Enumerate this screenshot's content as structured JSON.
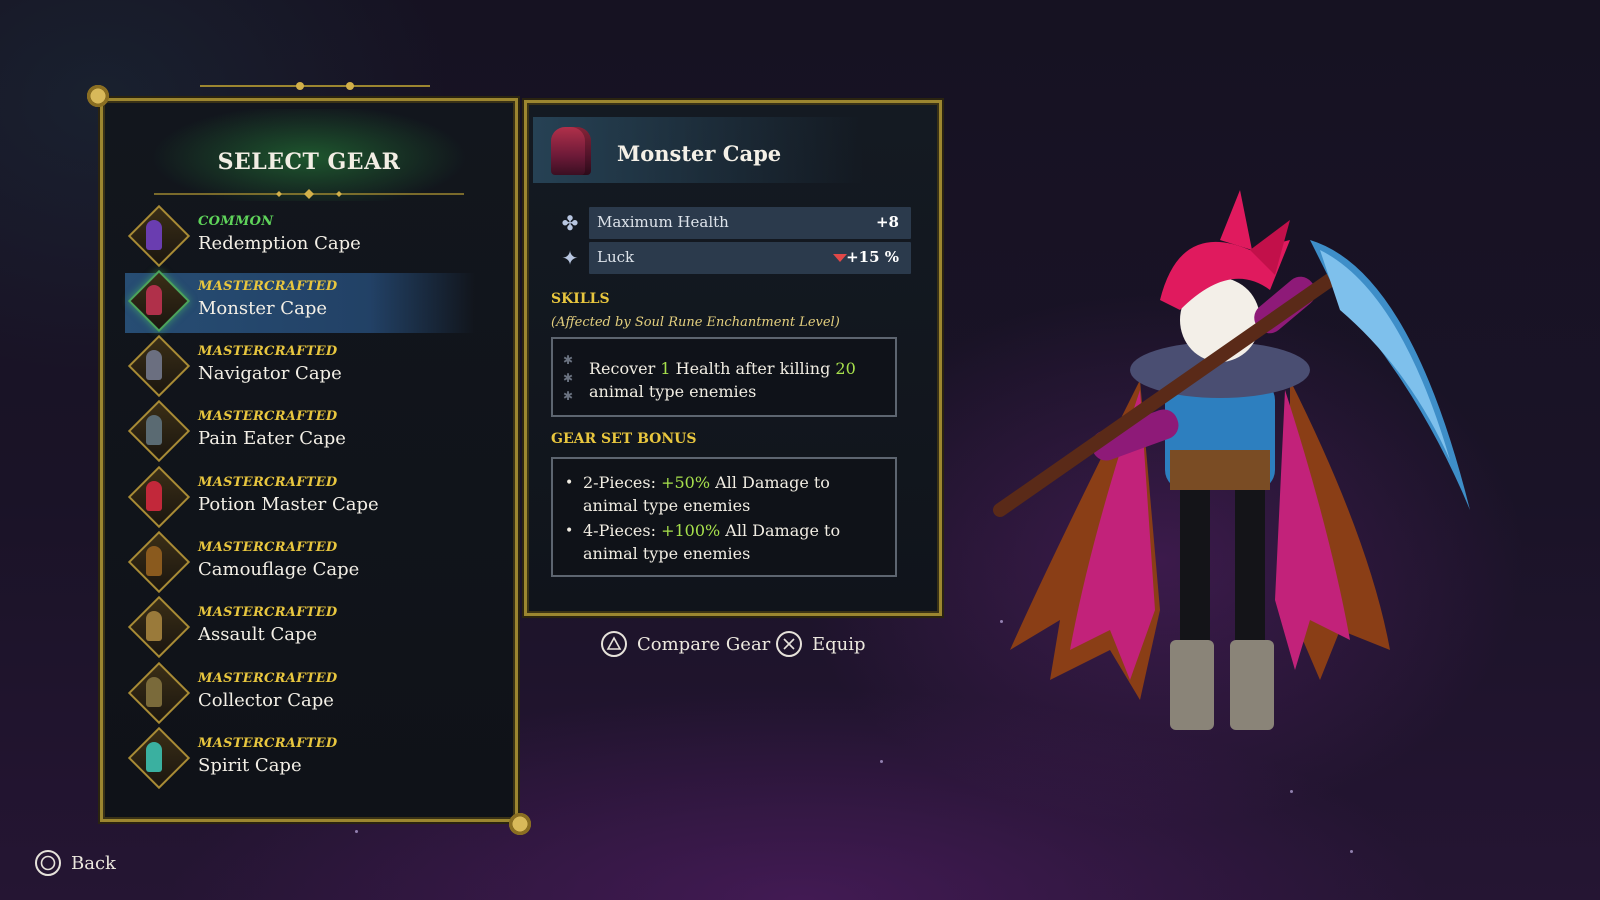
{
  "gear_list": {
    "title": "SELECT GEAR",
    "items": [
      {
        "rarity": "COMMON",
        "name": "Redemption Cape",
        "color": "#6a3db0"
      },
      {
        "rarity": "MASTERCRAFTED",
        "name": "Monster Cape",
        "color": "#b0304a",
        "selected": true
      },
      {
        "rarity": "MASTERCRAFTED",
        "name": "Navigator Cape",
        "color": "#6b6f80"
      },
      {
        "rarity": "MASTERCRAFTED",
        "name": "Pain Eater Cape",
        "color": "#5a6a72"
      },
      {
        "rarity": "MASTERCRAFTED",
        "name": "Potion Master Cape",
        "color": "#c2283a"
      },
      {
        "rarity": "MASTERCRAFTED",
        "name": "Camouflage Cape",
        "color": "#8a5a1e"
      },
      {
        "rarity": "MASTERCRAFTED",
        "name": "Assault Cape",
        "color": "#9a7a3a"
      },
      {
        "rarity": "MASTERCRAFTED",
        "name": "Collector Cape",
        "color": "#7a6a3a"
      },
      {
        "rarity": "MASTERCRAFTED",
        "name": "Spirit Cape",
        "color": "#3ab0a0"
      }
    ]
  },
  "detail": {
    "title": "Monster Cape",
    "stats": [
      {
        "icon": "health-clover-icon",
        "label": "Maximum Health",
        "value": "+8"
      },
      {
        "icon": "luck-sparkle-icon",
        "label": "Luck",
        "value": "+15 %",
        "trend": "down"
      }
    ],
    "skills_label": "SKILLS",
    "skills_note": "(Affected by Soul Rune Enchantment Level)",
    "skill": {
      "part1": "Recover ",
      "amount": "1",
      "part2": " Health after killing ",
      "count": "20",
      "part3": "animal type enemies"
    },
    "gear_set_label": "GEAR SET BONUS",
    "bonuses": [
      {
        "prefix": "2-Pieces: ",
        "value": "+50%",
        "suffix": " All Damage to animal type enemies"
      },
      {
        "prefix": "4-Pieces: ",
        "value": "+100%",
        "suffix": " All Damage to animal type enemies"
      }
    ]
  },
  "prompts": {
    "compare": "Compare Gear",
    "equip": "Equip",
    "back": "Back"
  },
  "colors": {
    "gold_border": "#9c8630",
    "mastercrafted": "#e8c63e",
    "common": "#5fd45a",
    "highlight_green": "#a7e04c",
    "selected_row": "#284e78"
  }
}
